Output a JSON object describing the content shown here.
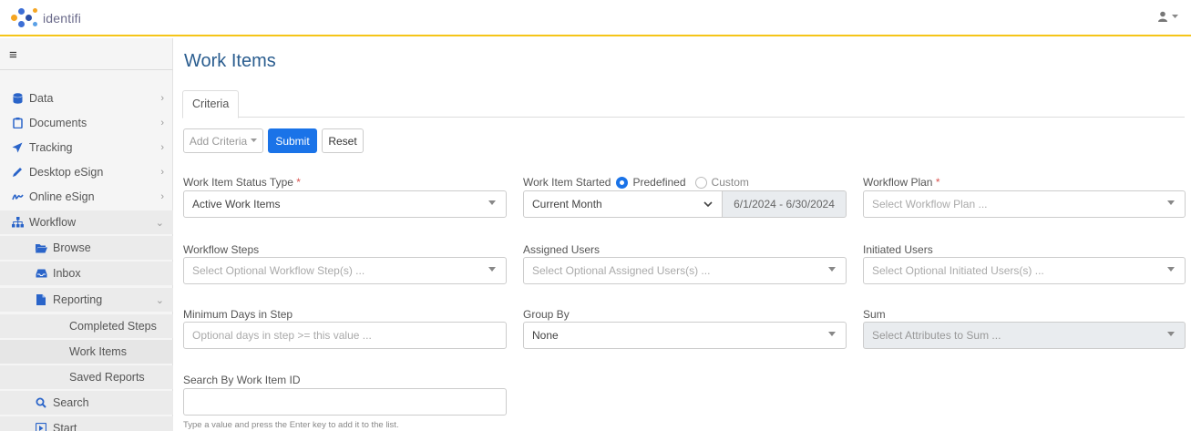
{
  "app": {
    "logo_text": "identifi"
  },
  "sidebar": {
    "items": [
      {
        "label": "Data",
        "icon": "database-icon"
      },
      {
        "label": "Documents",
        "icon": "clipboard-icon"
      },
      {
        "label": "Tracking",
        "icon": "paper-plane-icon"
      },
      {
        "label": "Desktop eSign",
        "icon": "pen-icon"
      },
      {
        "label": "Online eSign",
        "icon": "signature-icon"
      },
      {
        "label": "Workflow",
        "icon": "sitemap-icon"
      },
      {
        "label": "Browse",
        "icon": "folder-open-icon"
      },
      {
        "label": "Inbox",
        "icon": "inbox-icon"
      },
      {
        "label": "Reporting",
        "icon": "file-icon"
      },
      {
        "label": "Completed Steps"
      },
      {
        "label": "Work Items"
      },
      {
        "label": "Saved Reports"
      },
      {
        "label": "Search",
        "icon": "search-icon"
      },
      {
        "label": "Start",
        "icon": "start-icon"
      }
    ]
  },
  "main": {
    "title": "Work Items",
    "tab": "Criteria",
    "toolbar": {
      "add_criteria": "Add Criteria",
      "submit": "Submit",
      "reset": "Reset"
    },
    "fields": {
      "status_type": {
        "label": "Work Item Status Type",
        "required": "*",
        "value": "Active Work Items"
      },
      "started": {
        "label": "Work Item Started",
        "opt_predefined": "Predefined",
        "opt_custom": "Custom",
        "value": "Current Month",
        "range": "6/1/2024 - 6/30/2024"
      },
      "workflow_plan": {
        "label": "Workflow Plan",
        "required": "*",
        "placeholder": "Select Workflow Plan ..."
      },
      "workflow_steps": {
        "label": "Workflow Steps",
        "placeholder": "Select Optional Workflow Step(s) ..."
      },
      "assigned_users": {
        "label": "Assigned Users",
        "placeholder": "Select Optional Assigned Users(s) ..."
      },
      "initiated_users": {
        "label": "Initiated Users",
        "placeholder": "Select Optional Initiated Users(s) ..."
      },
      "min_days": {
        "label": "Minimum Days in Step",
        "placeholder": "Optional days in step >= this value ..."
      },
      "group_by": {
        "label": "Group By",
        "value": "None"
      },
      "sum": {
        "label": "Sum",
        "placeholder": "Select Attributes to Sum ..."
      },
      "search_id": {
        "label": "Search By Work Item ID",
        "help": "Type a value and press the Enter key to add it to the list."
      }
    }
  },
  "colors": {
    "accent": "#1a73e8",
    "title": "#2a5d8f",
    "topbar_border": "#f5c518"
  }
}
